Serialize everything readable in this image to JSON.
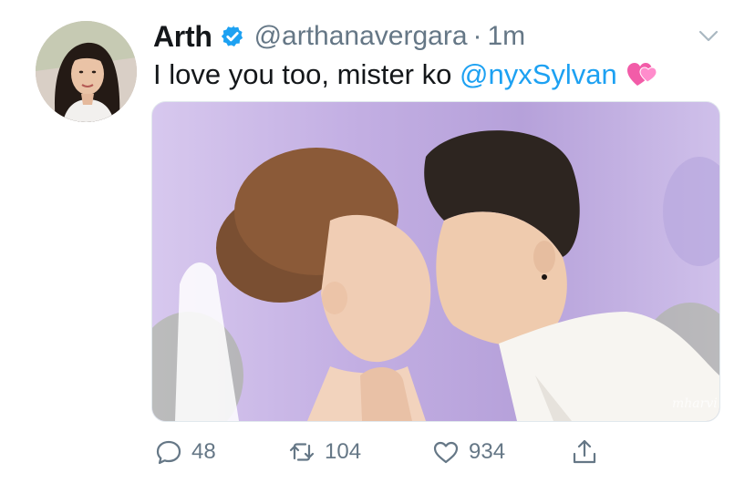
{
  "tweet": {
    "display_name": "Arth",
    "handle": "@arthanavergara",
    "separator": "·",
    "time": "1m",
    "text_prefix": "I love you too, mister ko ",
    "mention": "@nyxSylvan",
    "media_watermark": "mharvi"
  },
  "icons": {
    "verified": "verified-badge-icon",
    "caret": "chevron-down-icon",
    "emoji": "two-hearts-emoji",
    "reply": "reply-icon",
    "retweet": "retweet-icon",
    "like": "heart-icon",
    "share": "share-icon"
  },
  "actions": {
    "reply_count": "48",
    "retweet_count": "104",
    "like_count": "934"
  },
  "colors": {
    "link": "#1da1f2",
    "muted": "#657786",
    "text": "#14171a"
  }
}
